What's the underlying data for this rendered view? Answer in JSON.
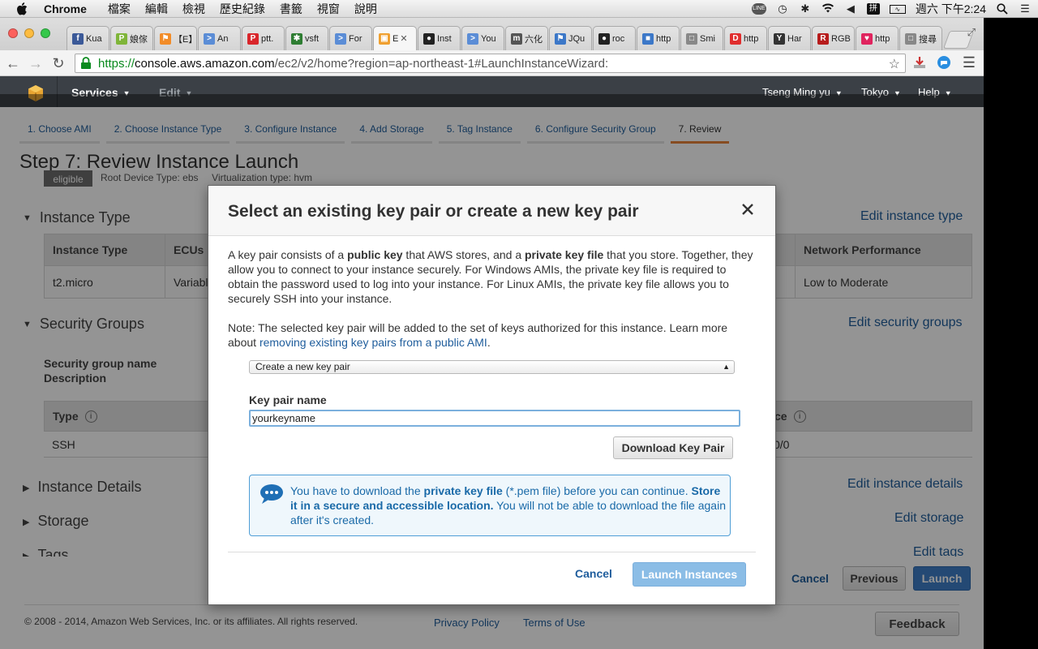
{
  "menubar": {
    "app": "Chrome",
    "items": [
      "檔案",
      "編輯",
      "檢視",
      "歷史紀錄",
      "書籤",
      "視窗",
      "說明"
    ],
    "clock": "週六 下午2:24"
  },
  "tabs": [
    {
      "label": "Kua",
      "color": "#3b5998",
      "glyph": "f"
    },
    {
      "label": "娘傢",
      "color": "#7fb539",
      "glyph": "P"
    },
    {
      "label": "【E】",
      "color": "#f28c28",
      "glyph": "⚑"
    },
    {
      "label": "An",
      "color": "#5b8dd6",
      "glyph": ">"
    },
    {
      "label": "ptt.",
      "color": "#d9262b",
      "glyph": "P"
    },
    {
      "label": "vsft",
      "color": "#2e7d32",
      "glyph": "✱"
    },
    {
      "label": "For",
      "color": "#5b8dd6",
      "glyph": ">"
    },
    {
      "label": "E",
      "color": "#f0a030",
      "glyph": "▣",
      "active": true
    },
    {
      "label": "Inst",
      "color": "#222",
      "glyph": "●"
    },
    {
      "label": "You",
      "color": "#5b8dd6",
      "glyph": ">"
    },
    {
      "label": "六化",
      "color": "#555",
      "glyph": "m"
    },
    {
      "label": "JQu",
      "color": "#3c78c8",
      "glyph": "⚑"
    },
    {
      "label": "roc",
      "color": "#222",
      "glyph": "●"
    },
    {
      "label": "http",
      "color": "#3c78c8",
      "glyph": "■"
    },
    {
      "label": "Smi",
      "color": "#888",
      "glyph": "□"
    },
    {
      "label": "http",
      "color": "#e02e2e",
      "glyph": "D"
    },
    {
      "label": "Har",
      "color": "#333",
      "glyph": "Y"
    },
    {
      "label": "RGB",
      "color": "#b71c1c",
      "glyph": "R"
    },
    {
      "label": "http",
      "color": "#e0245e",
      "glyph": "♥"
    },
    {
      "label": "搜尋",
      "color": "#888",
      "glyph": "□"
    }
  ],
  "address": {
    "scheme": "https://",
    "host": "console.aws.amazon.com",
    "path": "/ec2/v2/home?region=ap-northeast-1#LaunchInstanceWizard:"
  },
  "awsnav": {
    "services": "Services",
    "edit": "Edit",
    "user": "Tseng Ming yu",
    "region": "Tokyo",
    "help": "Help"
  },
  "steps": [
    "1. Choose AMI",
    "2. Choose Instance Type",
    "3. Configure Instance",
    "4. Add Storage",
    "5. Tag Instance",
    "6. Configure Security Group",
    "7. Review"
  ],
  "page": {
    "title": "Step 7: Review Instance Launch",
    "badge": "eligible",
    "root_text": "Root Device Type: ebs     Virtualization type: hvm",
    "sec_instance_type": "Instance Type",
    "edit_instance_type": "Edit instance type",
    "it_headers": [
      "Instance Type",
      "ECUs",
      "Network Performance"
    ],
    "it_row": [
      "t2.micro",
      "Variable",
      "Low to Moderate"
    ],
    "sec_security_groups": "Security Groups",
    "edit_security_groups": "Edit security groups",
    "sg_name_label": "Security group name",
    "sg_desc_label": "Description",
    "sg_headers": [
      "Type",
      "ce"
    ],
    "sg_row": [
      "SSH",
      "0/0"
    ],
    "sec_instance_details": "Instance Details",
    "edit_instance_details": "Edit instance details",
    "sec_storage": "Storage",
    "edit_storage": "Edit storage",
    "sec_tags": "Tags",
    "edit_tags": "Edit tags",
    "cancel": "Cancel",
    "previous": "Previous",
    "launch": "Launch",
    "copyright": "© 2008 - 2014, Amazon Web Services, Inc. or its affiliates. All rights reserved.",
    "privacy": "Privacy Policy",
    "terms": "Terms of Use",
    "feedback": "Feedback"
  },
  "modal": {
    "title": "Select an existing key pair or create a new key pair",
    "p1_a": "A key pair consists of a ",
    "p1_b": "public key",
    "p1_c": " that AWS stores, and a ",
    "p1_d": "private key file",
    "p1_e": " that you store. Together, they allow you to connect to your instance securely. For Windows AMIs, the private key file is required to obtain the password used to log into your instance. For Linux AMIs, the private key file allows you to securely SSH into your instance.",
    "note_a": "Note: The selected key pair will be added to the set of keys authorized for this instance. Learn more about ",
    "note_link": "removing existing key pairs from a public AMI",
    "note_b": ".",
    "select_value": "Create a new key pair",
    "kp_label": "Key pair name",
    "kp_value": "yourkeyname",
    "download": "Download Key Pair",
    "info_a": "You have to download the ",
    "info_b": "private key file",
    "info_c": " (*.pem file) before you can continue. ",
    "info_d": "Store it in a secure and accessible location.",
    "info_e": " You will not be able to download the file again after it's created.",
    "cancel": "Cancel",
    "launch": "Launch Instances"
  },
  "colors": {
    "aws_header": "#3b4046",
    "link": "#1f5d9c",
    "step_active": "#e8833a",
    "launch_btn": "#3f7fc8",
    "launch_disabled": "#8bbde6"
  }
}
